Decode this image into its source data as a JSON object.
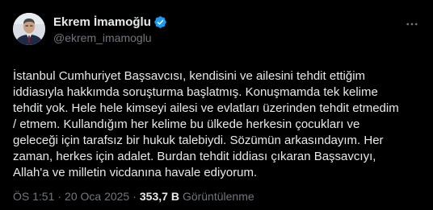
{
  "author": {
    "display_name": "Ekrem İmamoğlu",
    "handle": "@ekrem_imamoglu",
    "avatar_icon": "profile-photo",
    "verified_icon": "verified-badge-icon",
    "verified_color": "#1d9bf0"
  },
  "more_icon": "more-horizontal-icon",
  "tweet": {
    "text": "İstanbul Cumhuriyet Başsavcısı, kendisini ve ailesini tehdit ettiğim\niddiasıyla hakkımda soruşturma başlatmış. Konuşmamda tek kelime\ntehdit yok. Hele hele kimseyi ailesi ve evlatları üzerinden tehdit etmedim\n/ etmem. Kullandığım her kelime bu ülkede herkesin çocukları ve\ngeleceği için tarafsız bir hukuk talebiydi. Sözümün arkasındayım. Her\nzaman, herkes için adalet. Burdan tehdit iddiası çıkaran Başsavcıyı,\nAllah'a ve milletin vicdanına havale ediyorum.",
    "time": "ÖS 1:51",
    "separator": "·",
    "date": "20 Oca 2025",
    "views_count": "353,7 B",
    "views_label": "Görüntülenme"
  },
  "colors": {
    "background": "#000000",
    "primary_text": "#e7e9ea",
    "secondary_text": "#71767b"
  }
}
